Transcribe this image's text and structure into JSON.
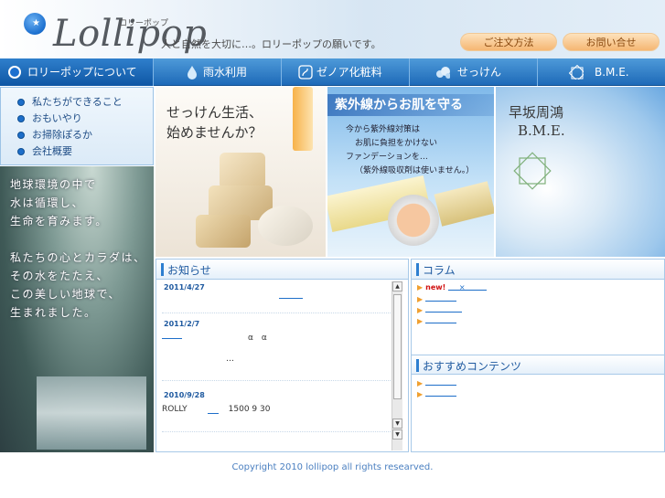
{
  "header": {
    "logo_text": "Lollipop",
    "logo_kana": "ロリーポップ",
    "tagline": "人と自然を大切に…。ロリーポップの願いです。",
    "order_button": "ご注文方法",
    "contact_button": "お問い合せ"
  },
  "nav": {
    "items": [
      {
        "label": "ロリーポップについて",
        "icon": "blue-dot-icon"
      },
      {
        "label": "雨水利用",
        "icon": "water-drop-icon"
      },
      {
        "label": "ゼノア化粧料",
        "icon": "cosmetic-icon"
      },
      {
        "label": "せっけん",
        "icon": "bubbles-icon"
      },
      {
        "label": "B.M.E.",
        "icon": "star-emblem-icon"
      }
    ]
  },
  "submenu": {
    "items": [
      {
        "label": "私たちができること"
      },
      {
        "label": "おもいやり"
      },
      {
        "label": "お掃除ぽるか"
      },
      {
        "label": "会社概要"
      }
    ]
  },
  "left_photo": {
    "poem_lines": [
      "地球環境の中で",
      "水は循環し、",
      "生命を育みます。",
      "",
      "私たちの心とカラダは、",
      "その水をたたえ、",
      "この美しい地球で、",
      "生まれました。"
    ]
  },
  "banners": {
    "soap": {
      "title_line1": "せっけん生活、",
      "title_line2": "始めませんか？"
    },
    "uv": {
      "title": "紫外線からお肌を守る",
      "lines": [
        "今から紫外線対策は",
        "お肌に負担をかけない",
        "ファンデーションを…",
        "（紫外線吸収剤は使いません。）"
      ]
    },
    "bme": {
      "title_line1": "早坂周鴻",
      "title_line2": "B.M.E."
    }
  },
  "news": {
    "title": "お知らせ",
    "entries": [
      {
        "date": "2011/4/27",
        "text": ""
      },
      {
        "date": "2011/2/7",
        "text": "α　α"
      },
      {
        "date": "",
        "text": "…"
      },
      {
        "date": "2010/9/28",
        "text": "ROLLY　　　　　1500  9 30"
      }
    ]
  },
  "column": {
    "title": "コラム",
    "new_label": "new!",
    "extra": "×"
  },
  "osusume": {
    "title": "おすすめコンテンツ"
  },
  "footer": {
    "copyright": "Copyright 2010 lollipop all rights researved."
  },
  "colors": {
    "nav_blue": "#1e6ab8",
    "accent_orange": "#f5b673",
    "link_blue": "#1d6ec9"
  }
}
